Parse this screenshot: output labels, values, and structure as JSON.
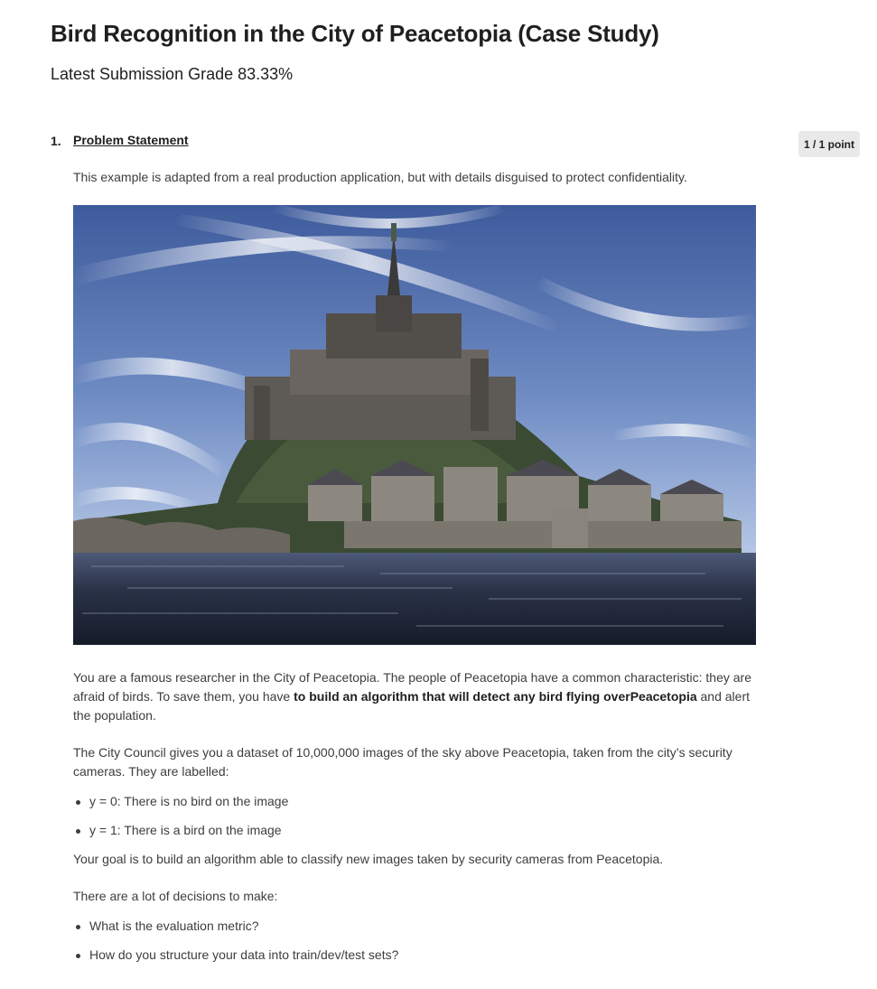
{
  "page": {
    "title": "Bird Recognition in the City of Peacetopia (Case Study)",
    "grade": "Latest Submission Grade 83.33%"
  },
  "question": {
    "number": "1.",
    "title": "Problem Statement",
    "points": "1 / 1 point",
    "intro": "This example is adapted from a real production application, but with details disguised to protect confidentiality.",
    "image": {
      "subject": "castle-on-island-photo"
    },
    "paragraph1": {
      "before": "You are a famous researcher in the City of Peacetopia. The people of Peacetopia have a common characteristic: they are afraid of birds. To save them, you have ",
      "bold": "to build an algorithm that will detect any bird flying overPeacetopia",
      "after": " and alert the population."
    },
    "paragraph2": "The City Council gives you a dataset of 10,000,000 images of the sky above Peacetopia, taken from the city’s security cameras. They are labelled:",
    "labels": [
      "y = 0: There is no bird on the image",
      "y = 1: There is a bird on the image"
    ],
    "paragraph3": "Your goal is to build an algorithm able to classify new images taken by security cameras from Peacetopia.",
    "paragraph4": "There are a lot of decisions to make:",
    "decisions": [
      "What is the evaluation metric?",
      "How do you structure your data into train/dev/test sets?"
    ]
  },
  "colors": {
    "badge_bg": "#e9e9e9",
    "text_primary": "#1f1f1f",
    "text_body": "#3d3d3d",
    "sky_top": "#3e5b9c",
    "sky_bottom": "#b7c8e6",
    "water": "#1c2436"
  }
}
